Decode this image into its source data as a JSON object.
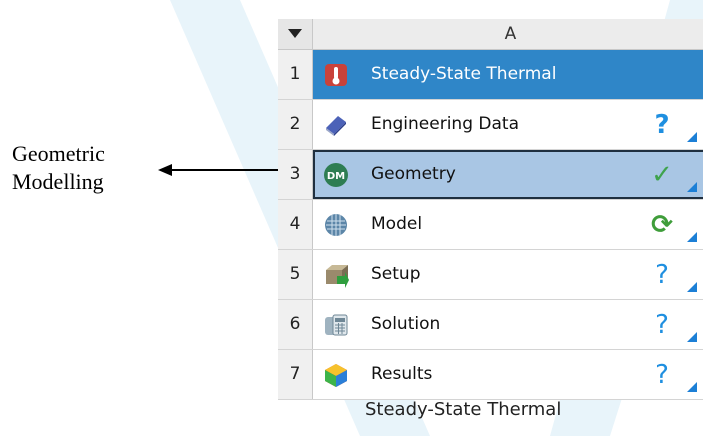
{
  "annotation": {
    "line1": "Geometric",
    "line2": "Modelling"
  },
  "system": {
    "column_header": "A",
    "caption": "Steady-State Thermal",
    "rows": [
      {
        "num": "1",
        "label": "Steady-State Thermal",
        "icon": "thermometer-icon",
        "status": ""
      },
      {
        "num": "2",
        "label": "Engineering Data",
        "icon": "book-icon",
        "status": "question"
      },
      {
        "num": "3",
        "label": "Geometry",
        "icon": "designmodeler-icon",
        "status": "check"
      },
      {
        "num": "4",
        "label": "Model",
        "icon": "mesh-cube-icon",
        "status": "refresh"
      },
      {
        "num": "5",
        "label": "Setup",
        "icon": "setup-icon",
        "status": "question-outline"
      },
      {
        "num": "6",
        "label": "Solution",
        "icon": "calculator-icon",
        "status": "question-outline"
      },
      {
        "num": "7",
        "label": "Results",
        "icon": "contour-results-icon",
        "status": "question-outline"
      }
    ]
  },
  "colors": {
    "title_row": "#2f86c8",
    "selected_row": "#a9c6e4",
    "check": "#3fa34d",
    "question": "#1f8fe0",
    "refresh": "#3f9d3a"
  }
}
